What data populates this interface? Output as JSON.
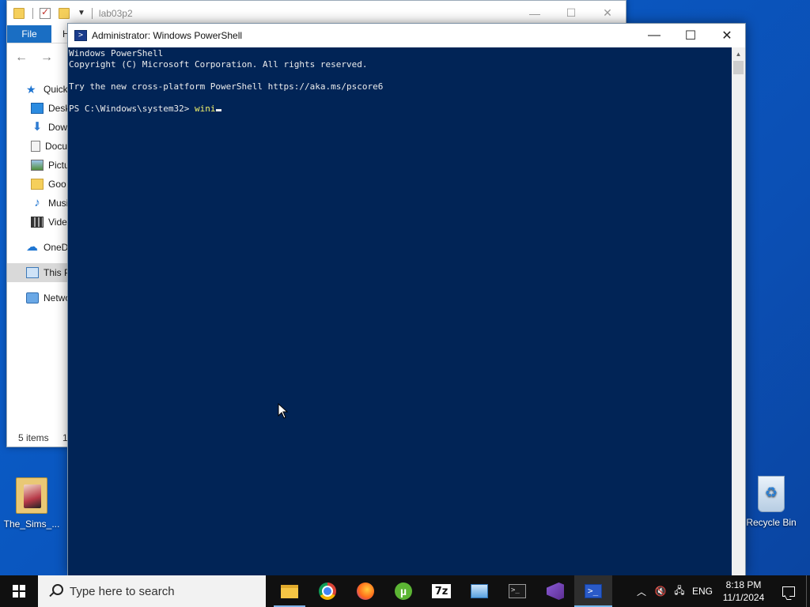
{
  "desktop": {
    "icons": [
      {
        "label": "The_Sims_..."
      },
      {
        "label": "Recycle Bin"
      }
    ]
  },
  "explorer": {
    "title": "lab03p2",
    "file_tab": "File",
    "home_tab": "H",
    "nav": [
      {
        "label": "Quick",
        "icon": "star-icon"
      },
      {
        "label": "Desk",
        "icon": "desktop-icon"
      },
      {
        "label": "Dow",
        "icon": "download-icon"
      },
      {
        "label": "Docu",
        "icon": "document-icon"
      },
      {
        "label": "Pictu",
        "icon": "pictures-icon"
      },
      {
        "label": "Goo",
        "icon": "folder-icon"
      },
      {
        "label": "Musi",
        "icon": "music-icon"
      },
      {
        "label": "Vide",
        "icon": "video-icon"
      },
      {
        "label": "OneDr",
        "icon": "onedrive-icon"
      },
      {
        "label": "This P",
        "icon": "this-pc-icon"
      },
      {
        "label": "Netwo",
        "icon": "network-icon"
      }
    ],
    "status": "5 items",
    "status_extra": "1"
  },
  "powershell": {
    "title": "Administrator: Windows PowerShell",
    "lines": [
      "Windows PowerShell",
      "Copyright (C) Microsoft Corporation. All rights reserved.",
      "",
      "Try the new cross-platform PowerShell https://aka.ms/pscore6",
      ""
    ],
    "prompt": "PS C:\\Windows\\system32> ",
    "command": "wini"
  },
  "taskbar": {
    "search_placeholder": "Type here to search",
    "apps": [
      {
        "name": "File Explorer",
        "icon": "file-explorer-icon",
        "running": true
      },
      {
        "name": "Chrome",
        "icon": "chrome-icon",
        "running": false
      },
      {
        "name": "Firefox",
        "icon": "firefox-icon",
        "running": false
      },
      {
        "name": "uTorrent",
        "icon": "utorrent-icon",
        "running": false
      },
      {
        "name": "7-Zip",
        "icon": "7zip-icon",
        "running": false
      },
      {
        "name": "Control Panel",
        "icon": "control-panel-icon",
        "running": false
      },
      {
        "name": "Command Prompt",
        "icon": "terminal-icon",
        "running": false
      },
      {
        "name": "Visual Studio",
        "icon": "visual-studio-icon",
        "running": false
      },
      {
        "name": "PowerShell",
        "icon": "powershell-icon",
        "running": true,
        "active": true
      }
    ],
    "language": "ENG",
    "time": "8:18 PM",
    "date": "11/1/2024",
    "sevenzip_label": "7z"
  }
}
